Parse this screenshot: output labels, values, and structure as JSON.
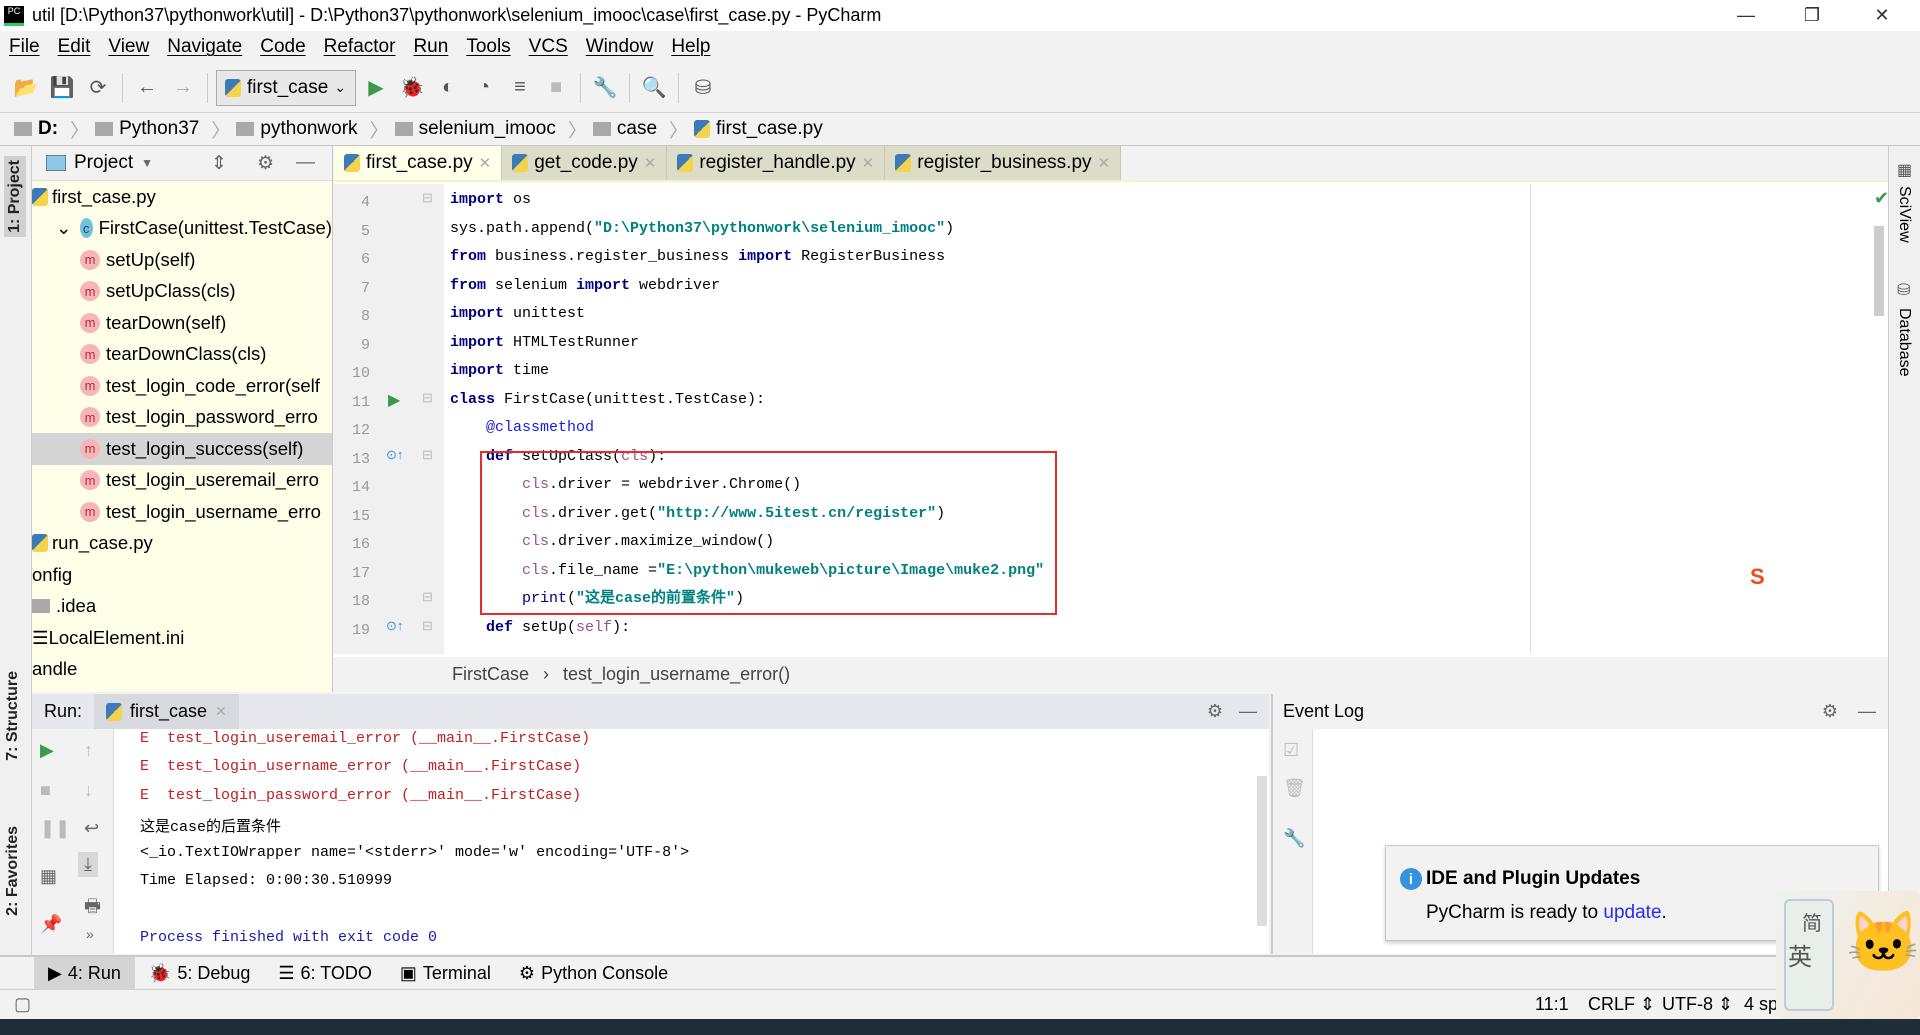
{
  "window": {
    "title": "util [D:\\Python37\\pythonwork\\util] - D:\\Python37\\pythonwork\\selenium_imooc\\case\\first_case.py - PyCharm",
    "app_icon": "PC"
  },
  "menu": [
    "File",
    "Edit",
    "View",
    "Navigate",
    "Code",
    "Refactor",
    "Run",
    "Tools",
    "VCS",
    "Window",
    "Help"
  ],
  "toolbar": {
    "run_config": "first_case"
  },
  "breadcrumb": [
    "D:",
    "Python37",
    "pythonwork",
    "selenium_imooc",
    "case",
    "first_case.py"
  ],
  "left_stripe": {
    "project": "1: Project",
    "structure": "7: Structure",
    "favorites": "2: Favorites"
  },
  "right_stripe": {
    "sciview": "SciView",
    "database": "Database"
  },
  "project": {
    "title": "Project",
    "items": [
      {
        "label": "first_case.py",
        "kind": "py",
        "indent": 0
      },
      {
        "label": "FirstCase(unittest.TestCase)",
        "kind": "class",
        "indent": 1
      },
      {
        "label": "setUp(self)",
        "kind": "method",
        "indent": 2
      },
      {
        "label": "setUpClass(cls)",
        "kind": "method",
        "indent": 2
      },
      {
        "label": "tearDown(self)",
        "kind": "method",
        "indent": 2
      },
      {
        "label": "tearDownClass(cls)",
        "kind": "method",
        "indent": 2
      },
      {
        "label": "test_login_code_error(self",
        "kind": "method",
        "indent": 2
      },
      {
        "label": "test_login_password_erro",
        "kind": "method",
        "indent": 2
      },
      {
        "label": "test_login_success(self)",
        "kind": "method",
        "indent": 2,
        "selected": true
      },
      {
        "label": "test_login_useremail_erro",
        "kind": "method",
        "indent": 2
      },
      {
        "label": "test_login_username_erro",
        "kind": "method",
        "indent": 2
      },
      {
        "label": "run_case.py",
        "kind": "py",
        "indent": 0
      },
      {
        "label": "onfig",
        "kind": "none",
        "indent": 0
      },
      {
        "label": ".idea",
        "kind": "folder",
        "indent": 0
      },
      {
        "label": "LocalElement.ini",
        "kind": "ini",
        "indent": 0
      },
      {
        "label": "andle",
        "kind": "none",
        "indent": 0
      }
    ]
  },
  "editor": {
    "tabs": [
      {
        "label": "first_case.py",
        "active": true
      },
      {
        "label": "get_code.py"
      },
      {
        "label": "register_handle.py"
      },
      {
        "label": "register_business.py"
      }
    ],
    "lines": [
      {
        "n": "4",
        "seg": [
          [
            "import",
            "kw"
          ],
          [
            " os",
            "plain"
          ]
        ]
      },
      {
        "n": "5",
        "seg": [
          [
            "sys.path.append(",
            "plain"
          ],
          [
            "\"D:\\Python37\\pythonwork\\selenium_imooc\"",
            "str"
          ],
          [
            ")",
            "plain"
          ]
        ]
      },
      {
        "n": "6",
        "seg": [
          [
            "from",
            "kw"
          ],
          [
            " business.register_business ",
            "plain"
          ],
          [
            "import",
            "kw"
          ],
          [
            " RegisterBusiness",
            "plain"
          ]
        ]
      },
      {
        "n": "7",
        "seg": [
          [
            "from",
            "kw"
          ],
          [
            " selenium ",
            "plain"
          ],
          [
            "import",
            "kw"
          ],
          [
            " webdriver",
            "plain"
          ]
        ]
      },
      {
        "n": "8",
        "seg": [
          [
            "import",
            "kw"
          ],
          [
            " unittest",
            "plain"
          ]
        ]
      },
      {
        "n": "9",
        "seg": [
          [
            "import",
            "kw"
          ],
          [
            " HTMLTestRunner",
            "plain"
          ]
        ]
      },
      {
        "n": "10",
        "seg": [
          [
            "import",
            "kw"
          ],
          [
            " time",
            "plain"
          ]
        ]
      },
      {
        "n": "11",
        "seg": [
          [
            "class",
            "kw"
          ],
          [
            " FirstCase(unittest.TestCase):",
            "plain"
          ]
        ]
      },
      {
        "n": "12",
        "seg": [
          [
            "    ",
            "plain"
          ],
          [
            "@classmethod",
            "dec"
          ]
        ]
      },
      {
        "n": "13",
        "seg": [
          [
            "    ",
            "plain"
          ],
          [
            "def",
            "kw"
          ],
          [
            " setUpClass(",
            "plain"
          ],
          [
            "cls",
            "self"
          ],
          [
            "):",
            "plain"
          ]
        ]
      },
      {
        "n": "14",
        "seg": [
          [
            "        ",
            "plain"
          ],
          [
            "cls",
            "self"
          ],
          [
            ".driver = webdriver.Chrome()",
            "plain"
          ]
        ]
      },
      {
        "n": "15",
        "seg": [
          [
            "        ",
            "plain"
          ],
          [
            "cls",
            "self"
          ],
          [
            ".driver.get(",
            "plain"
          ],
          [
            "\"http://www.5itest.cn/register\"",
            "str"
          ],
          [
            ")",
            "plain"
          ]
        ]
      },
      {
        "n": "16",
        "seg": [
          [
            "        ",
            "plain"
          ],
          [
            "cls",
            "self"
          ],
          [
            ".driver.maximize_window()",
            "plain"
          ]
        ]
      },
      {
        "n": "17",
        "seg": [
          [
            "        ",
            "plain"
          ],
          [
            "cls",
            "self"
          ],
          [
            ".file_name =",
            "plain"
          ],
          [
            "\"E:\\python\\mukeweb\\picture\\Image\\muke2.png\"",
            "str"
          ]
        ]
      },
      {
        "n": "18",
        "seg": [
          [
            "        ",
            "plain"
          ],
          [
            "print",
            "fn"
          ],
          [
            "(",
            "plain"
          ],
          [
            "\"这是case的前置条件\"",
            "str"
          ],
          [
            ")",
            "plain"
          ]
        ]
      },
      {
        "n": "19",
        "seg": [
          [
            "    ",
            "plain"
          ],
          [
            "def",
            "kw"
          ],
          [
            " setUp(",
            "plain"
          ],
          [
            "self",
            "self"
          ],
          [
            "):",
            "plain"
          ]
        ]
      }
    ],
    "crumbs": [
      "FirstCase",
      "test_login_username_error()"
    ]
  },
  "run": {
    "label": "Run:",
    "tab": "first_case",
    "lines": [
      {
        "t": "E  test_login_useremail_error (__main__.FirstCase)",
        "c": "err"
      },
      {
        "t": "E  test_login_username_error (__main__.FirstCase)",
        "c": "err"
      },
      {
        "t": "E  test_login_password_error (__main__.FirstCase)",
        "c": "err"
      },
      {
        "t": "这是case的后置条件",
        "c": "out"
      },
      {
        "t": "<_io.TextIOWrapper name='<stderr>' mode='w' encoding='UTF-8'>",
        "c": "out"
      },
      {
        "t": "Time Elapsed: 0:00:30.510999",
        "c": "out"
      },
      {
        "t": "",
        "c": "out"
      },
      {
        "t": "Process finished with exit code 0",
        "c": "sys"
      }
    ]
  },
  "event_log": {
    "title": "Event Log",
    "notification": {
      "title": "IDE and Plugin Updates",
      "text": "PyCharm is ready to ",
      "link": "update",
      "suffix": "."
    }
  },
  "bottom_tabs": [
    "4: Run",
    "5: Debug",
    "6: TODO",
    "Terminal",
    "Python Console"
  ],
  "status": {
    "position": "11:1",
    "line_sep": "CRLF",
    "encoding": "UTF-8",
    "indent": "4 sp"
  },
  "ime": {
    "mode1": "简",
    "mode2": "英"
  },
  "colors": {
    "keyword": "#000080",
    "string": "#008080",
    "self": "#94558d",
    "error": "#c02020",
    "highlight_box": "#e52b2b",
    "link": "#2a2af0"
  }
}
